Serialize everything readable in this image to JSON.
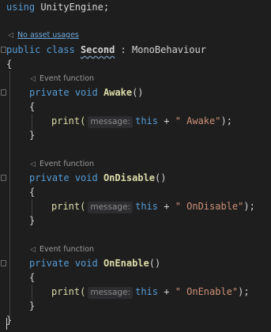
{
  "editor": {
    "line1": {
      "kw": "using",
      "ns": "UnityEngine",
      "end": ";"
    },
    "usages_hint": {
      "icon": "usages-icon",
      "text": "No asset usages"
    },
    "class_decl": {
      "kw1": "public",
      "kw2": "class",
      "name": "Second",
      "sep": " : ",
      "base": "MonoBehaviour"
    },
    "open_brace": "{",
    "close_brace": "}",
    "methods": [
      {
        "hint": "Event function",
        "kw1": "private",
        "kw2": "void",
        "name": "Awake",
        "parens": "()",
        "open": "{",
        "call": "print(",
        "param_hint": "message:",
        "expr_this": "this",
        "expr_plus": " + ",
        "expr_str": "\" Awake\"",
        "expr_end": ");",
        "close": "}"
      },
      {
        "hint": "Event function",
        "kw1": "private",
        "kw2": "void",
        "name": "OnDisable",
        "parens": "()",
        "open": "{",
        "call": "print(",
        "param_hint": "message:",
        "expr_this": "this",
        "expr_plus": " + ",
        "expr_str": "\" OnDisable\"",
        "expr_end": ");",
        "close": "}"
      },
      {
        "hint": "Event function",
        "kw1": "private",
        "kw2": "void",
        "name": "OnEnable",
        "parens": "()",
        "open": "{",
        "call": "print(",
        "param_hint": "message:",
        "expr_this": "this",
        "expr_plus": " + ",
        "expr_str": "\" OnEnable\"",
        "expr_end": ");",
        "close": "}"
      }
    ]
  },
  "colors": {
    "background": "#1e1e1e",
    "keyword": "#569cd6",
    "method": "#dcdcaa",
    "string": "#ce9178",
    "text": "#d4d4d4",
    "hint": "#9a9a9a",
    "link": "#6fa8dc"
  }
}
